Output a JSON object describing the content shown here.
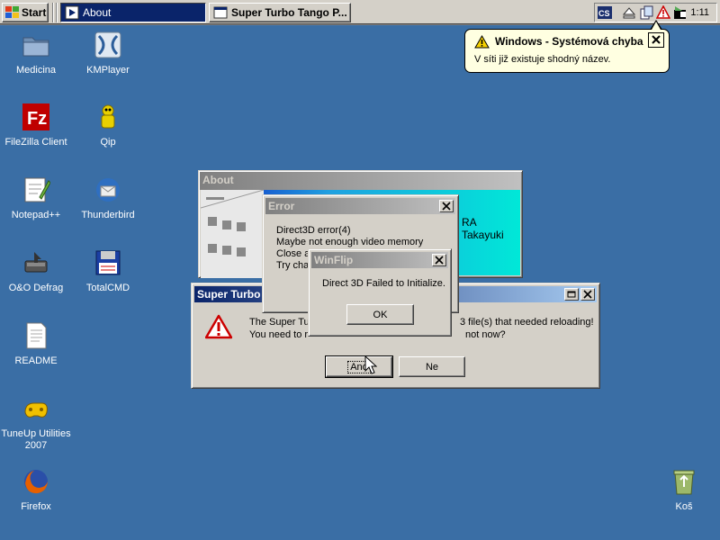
{
  "taskbar": {
    "start_label": "Start",
    "tasks": [
      {
        "label": "About"
      },
      {
        "label": "Super Turbo Tango P..."
      }
    ],
    "clock": "1:11"
  },
  "balloon": {
    "title": "Windows - Systémová chyba",
    "text": "V síti již existuje shodný název."
  },
  "desktop_icons": [
    {
      "label": "Medicina"
    },
    {
      "label": "KMPlayer"
    },
    {
      "label": "FileZilla Client"
    },
    {
      "label": "Qip"
    },
    {
      "label": "Notepad++"
    },
    {
      "label": "Thunderbird"
    },
    {
      "label": "O&O Defrag"
    },
    {
      "label": "TotalCMD"
    },
    {
      "label": "README"
    },
    {
      "label": "TuneUp Utilities 2007"
    },
    {
      "label": "Firefox"
    },
    {
      "label": "Koš"
    }
  ],
  "about_window": {
    "title": "About",
    "visible_text": "RA Takayuki"
  },
  "super_window": {
    "title": "Super Turbo",
    "line1_left": "The Super Tu",
    "line1_right": "3 file(s) that needed reloading!",
    "line2_left": "You need to r",
    "line2_right": "not now?",
    "yes_label": "Ano",
    "no_label": "Ne"
  },
  "error_window": {
    "title": "Error",
    "lines": [
      "Direct3D error(4)",
      "Maybe not enough video memory",
      "Close a",
      "Try cha"
    ]
  },
  "winflip_window": {
    "title": "WinFlip",
    "message": "Direct 3D Failed to Initialize.",
    "ok_label": "OK"
  },
  "colors": {
    "desktop": "#3a6ea5",
    "active_title": "#0a246a",
    "inactive_title": "#808080",
    "about_panel": "#00e8d8"
  }
}
